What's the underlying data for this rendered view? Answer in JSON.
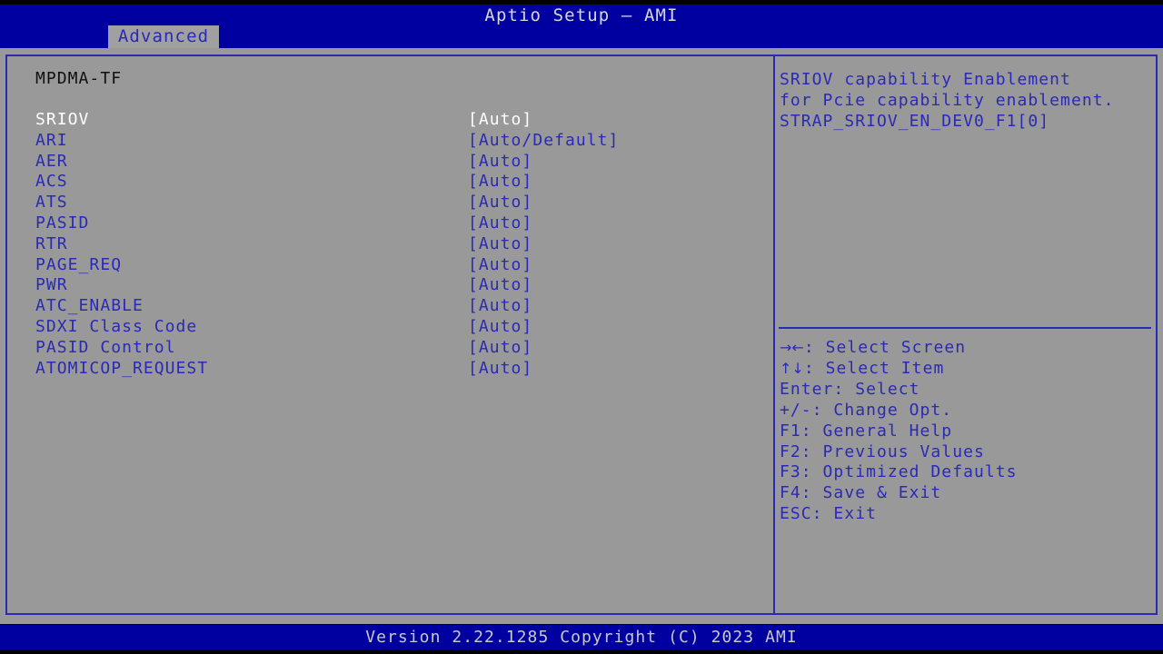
{
  "header": {
    "title": "Aptio Setup – AMI",
    "tab_label": "Advanced"
  },
  "main": {
    "section_header": "MPDMA-TF",
    "options": [
      {
        "label": "SRIOV",
        "value": "[Auto]",
        "selected": true
      },
      {
        "label": "ARI",
        "value": "[Auto/Default]",
        "selected": false
      },
      {
        "label": "AER",
        "value": "[Auto]",
        "selected": false
      },
      {
        "label": "ACS",
        "value": "[Auto]",
        "selected": false
      },
      {
        "label": "ATS",
        "value": "[Auto]",
        "selected": false
      },
      {
        "label": "PASID",
        "value": "[Auto]",
        "selected": false
      },
      {
        "label": "RTR",
        "value": "[Auto]",
        "selected": false
      },
      {
        "label": "PAGE_REQ",
        "value": "[Auto]",
        "selected": false
      },
      {
        "label": "PWR",
        "value": "[Auto]",
        "selected": false
      },
      {
        "label": "ATC_ENABLE",
        "value": "[Auto]",
        "selected": false
      },
      {
        "label": "SDXI Class Code",
        "value": "[Auto]",
        "selected": false
      },
      {
        "label": "PASID Control",
        "value": "[Auto]",
        "selected": false
      },
      {
        "label": "ATOMICOP_REQUEST",
        "value": "[Auto]",
        "selected": false
      }
    ]
  },
  "help": {
    "lines": [
      "SRIOV capability Enablement",
      "for Pcie capability enablement.",
      "STRAP_SRIOV_EN_DEV0_F1[0]"
    ]
  },
  "legend": {
    "items": [
      {
        "glyph": "→←",
        "text": ": Select Screen"
      },
      {
        "glyph": "↑↓",
        "text": ": Select Item"
      },
      {
        "glyph": "",
        "text": "Enter: Select"
      },
      {
        "glyph": "",
        "text": "+/-: Change Opt."
      },
      {
        "glyph": "",
        "text": "F1: General Help"
      },
      {
        "glyph": "",
        "text": "F2: Previous Values"
      },
      {
        "glyph": "",
        "text": "F3: Optimized Defaults"
      },
      {
        "glyph": "",
        "text": "F4: Save & Exit"
      },
      {
        "glyph": "",
        "text": "ESC: Exit"
      }
    ]
  },
  "footer": {
    "version_text": "Version 2.22.1285 Copyright (C) 2023 AMI"
  },
  "colors": {
    "header_bar": "#0000a0",
    "body_background": "#999999",
    "border": "#2a2ab4",
    "item_text": "#2a2ab4",
    "selected_text": "#ffffff",
    "section_header_text": "#101010",
    "footer_text": "#c8c8c8"
  }
}
